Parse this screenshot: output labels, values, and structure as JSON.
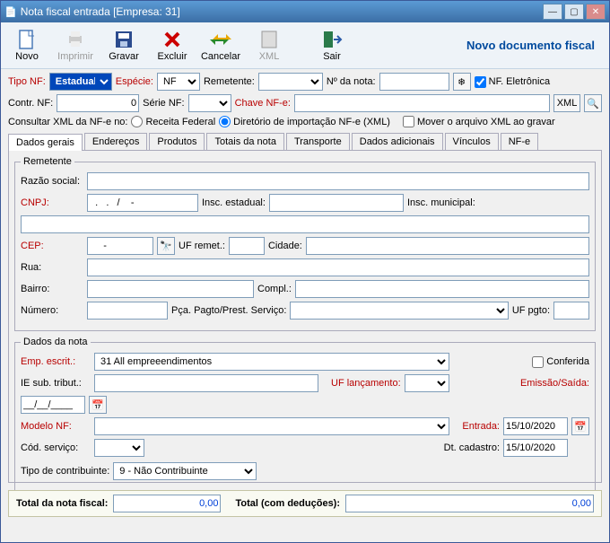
{
  "window": {
    "title": "Nota fiscal entrada [Empresa: 31]"
  },
  "toolbar": {
    "novo": "Novo",
    "imprimir": "Imprimir",
    "gravar": "Gravar",
    "excluir": "Excluir",
    "cancelar": "Cancelar",
    "xml": "XML",
    "sair": "Sair",
    "novo_doc": "Novo documento fiscal"
  },
  "header": {
    "tipo_nf": "Tipo NF:",
    "tipo_nf_val": "Estadual",
    "especie": "Espécie:",
    "especie_val": "NF",
    "remetente": "Remetente:",
    "remetente_val": "",
    "n_nota": "Nº da nota:",
    "n_nota_val": "",
    "nf_eletronica": "NF. Eletrônica",
    "contr_nf": "Contr. NF:",
    "contr_nf_val": "0",
    "serie_nf": "Série NF:",
    "serie_nf_val": "",
    "chave_nfe": "Chave NF-e:",
    "chave_nfe_val": "",
    "btn_xml": "XML",
    "consultar_xml": "Consultar XML da NF-e no:",
    "receita": "Receita Federal",
    "diretorio": "Diretório de importação NF-e (XML)",
    "mover_xml": "Mover o arquivo XML ao gravar"
  },
  "tabs": [
    "Dados gerais",
    "Endereços",
    "Produtos",
    "Totais da nota",
    "Transporte",
    "Dados adicionais",
    "Vínculos",
    "NF-e"
  ],
  "remetente": {
    "legend": "Remetente",
    "razao": "Razão social:",
    "razao_val": "",
    "cnpj": "CNPJ:",
    "cnpj_val": "  .   .   /    -",
    "insc_est": "Insc. estadual:",
    "insc_est_val": "",
    "insc_mun": "Insc. municipal:",
    "insc_mun_val": "",
    "cep": "CEP:",
    "cep_val": "     -",
    "uf_remet": "UF remet.:",
    "uf_remet_val": "",
    "cidade": "Cidade:",
    "cidade_val": "",
    "rua": "Rua:",
    "rua_val": "",
    "bairro": "Bairro:",
    "bairro_val": "",
    "compl": "Compl.:",
    "compl_val": "",
    "numero": "Número:",
    "numero_val": "",
    "pca": "Pça. Pagto/Prest. Serviço:",
    "pca_val": "",
    "uf_pgto": "UF pgto:",
    "uf_pgto_val": ""
  },
  "dados_nota": {
    "legend": "Dados da nota",
    "emp_escrit": "Emp. escrit.:",
    "emp_escrit_val": "31  All empreeendimentos",
    "conferida": "Conferida",
    "ie_sub": "IE sub. tribut.:",
    "ie_sub_val": "",
    "uf_lanc": "UF lançamento:",
    "uf_lanc_val": "",
    "emissao": "Emissão/Saída:",
    "emissao_val": "__/__/____",
    "modelo_nf": "Modelo NF:",
    "modelo_nf_val": "",
    "entrada": "Entrada:",
    "entrada_val": "15/10/2020",
    "cod_servico": "Cód. serviço:",
    "cod_servico_val": "",
    "dt_cad": "Dt. cadastro:",
    "dt_cad_val": "15/10/2020",
    "tipo_contrib": "Tipo de contribuinte:",
    "tipo_contrib_val": "9 - Não Contribuinte"
  },
  "totals": {
    "total_nota": "Total da nota fiscal:",
    "total_nota_val": "0,00",
    "total_ded": "Total  (com deduções):",
    "total_ded_val": "0,00"
  }
}
